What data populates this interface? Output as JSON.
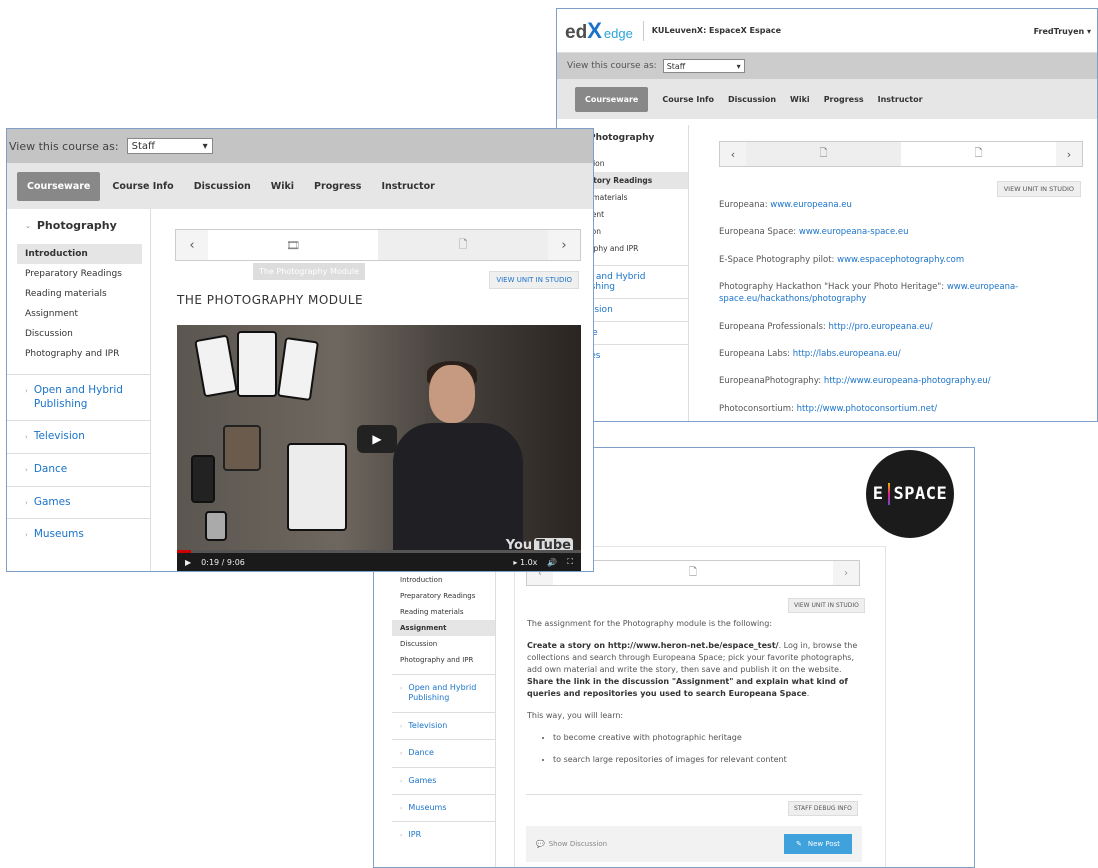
{
  "shot_a": {
    "logo": {
      "ed": "ed",
      "x": "X",
      "edge": "edge"
    },
    "course_name": "KULeuvenX: EspaceX Espace",
    "username": "FredTruyen",
    "view_as_label": "View this course as:",
    "view_as_value": "Staff",
    "tabs": [
      "Courseware",
      "Course Info",
      "Discussion",
      "Wiki",
      "Progress",
      "Instructor"
    ],
    "sidebar": {
      "chapter": "Photography",
      "items": [
        "roduction",
        "eparatory Readings",
        "ading materials",
        "signment",
        "scussion",
        "otography and IPR"
      ],
      "sections": [
        "Open and Hybrid Publishing",
        "Television",
        "Dance",
        "Games"
      ]
    },
    "view_unit_label": "VIEW UNIT IN STUDIO",
    "links": [
      {
        "label": "Europeana: ",
        "url": "www.europeana.eu"
      },
      {
        "label": "Europeana Space: ",
        "url": "www.europeana-space.eu"
      },
      {
        "label": "E-Space Photography pilot: ",
        "url": "www.espacephotography.com"
      },
      {
        "label": "Photography Hackathon \"Hack your Photo Heritage\": ",
        "url": "www.europeana-space.eu/hackathons/photography"
      },
      {
        "label": "Europeana Professionals: ",
        "url": "http://pro.europeana.eu/"
      },
      {
        "label": "Europeana Labs: ",
        "url": "http://labs.europeana.eu/"
      },
      {
        "label": "EuropeanaPhotography: ",
        "url": "http://www.europeana-photography.eu/"
      },
      {
        "label": "Photoconsortium: ",
        "url": "http://www.photoconsortium.net/"
      }
    ]
  },
  "shot_b": {
    "view_as_label": "View this course as:",
    "view_as_value": "Staff",
    "tabs": [
      "Courseware",
      "Course Info",
      "Discussion",
      "Wiki",
      "Progress",
      "Instructor"
    ],
    "sidebar": {
      "chapter": "Photography",
      "items": [
        "Introduction",
        "Preparatory Readings",
        "Reading materials",
        "Assignment",
        "Discussion",
        "Photography and IPR"
      ],
      "sections": [
        "Open and Hybrid Publishing",
        "Television",
        "Dance",
        "Games",
        "Museums"
      ]
    },
    "tooltip": "The Photography Module",
    "view_unit_label": "VIEW UNIT IN STUDIO",
    "unit_title": "THE PHOTOGRAPHY MODULE",
    "video": {
      "time": "0:19 / 9:06",
      "speed": "1.0x",
      "watermark_a": "You",
      "watermark_b": "Tube",
      "progress": 0.035
    }
  },
  "shot_c": {
    "sidebar": {
      "items": [
        "Introduction",
        "Preparatory Readings",
        "Reading materials",
        "Assignment",
        "Discussion",
        "Photography and IPR"
      ],
      "sections": [
        "Open and Hybrid Publishing",
        "Television",
        "Dance",
        "Games",
        "Museums",
        "IPR"
      ]
    },
    "view_unit_label": "VIEW UNIT IN STUDIO",
    "intro": "The assignment for the Photography module is the following:",
    "create_prefix": "Create a story on ",
    "create_link": "http://www.heron-net.be/espace_test/",
    "create_body": ". Log in, browse the collections and search through Europeana Space; pick your favorite photographs, add own material and write the story, then save and publish it on the website. ",
    "share_bold": "Share the link in the discussion \"Assignment\" and explain what kind of queries and repositories you used to ",
    "search_link": "search Europeana Space",
    "share_end": ".",
    "learn_intro": "This way, you will learn:",
    "bullets": [
      "to become creative with photographic heritage",
      "to search large repositories of images for relevant content"
    ],
    "debug_label": "STAFF DEBUG INFO",
    "show_discussion": "Show Discussion",
    "new_post": "New Post"
  },
  "badge": {
    "left": "E",
    "right": "SPACE"
  },
  "colors": {
    "link": "#1a73c9",
    "nav_active": "#888888",
    "view_bar": "#c4c4c4",
    "new_post": "#3fa2dc",
    "frame_border": "#7d9fc8"
  }
}
